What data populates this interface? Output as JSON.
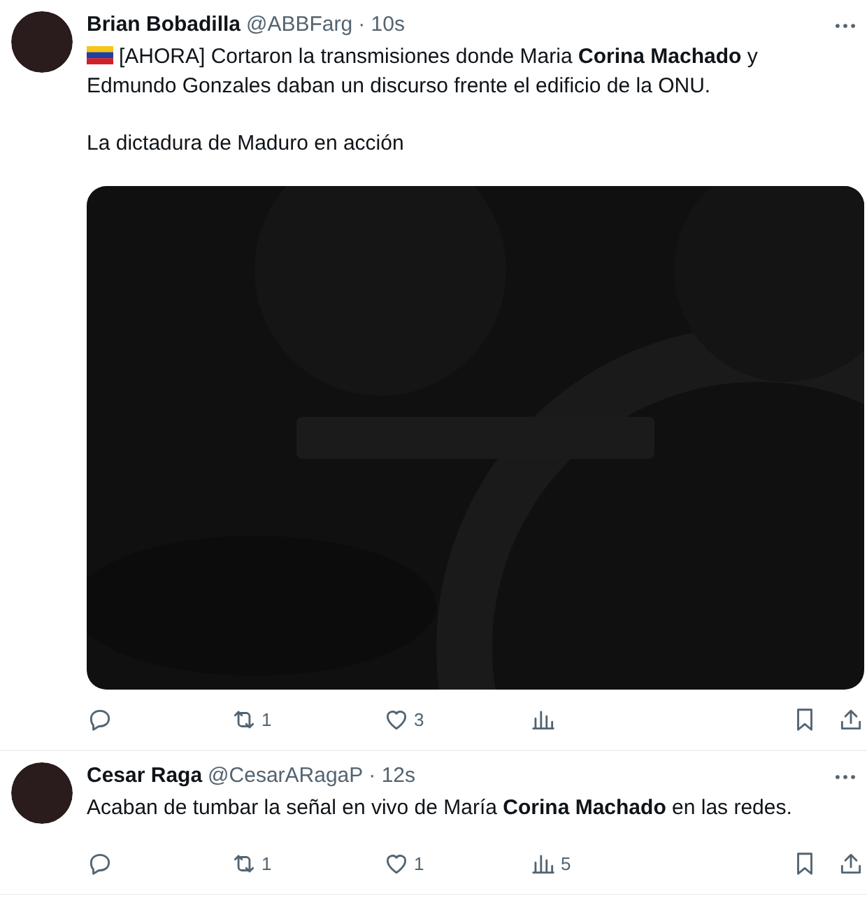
{
  "tweets": [
    {
      "name": "Brian Bobadilla",
      "handle": "@ABBFarg",
      "time": "· 10s",
      "flag": true,
      "paragraphs": [
        "[AHORA] Cortaron la transmisiones donde Maria **Corina Machado** y Edmundo Gonzales daban un discurso frente el edificio de la ONU.",
        "La dictadura de Maduro en acción"
      ],
      "actions": {
        "retweets": "1",
        "likes": "3"
      }
    },
    {
      "name": "Cesar Raga",
      "handle": "@CesarARagaP",
      "time": "· 12s",
      "paragraphs": [
        "Acaban de tumbar la señal en vivo de María **Corina Machado** en las redes."
      ],
      "actions": {
        "retweets": "1",
        "likes": "1",
        "views": "5"
      }
    }
  ]
}
